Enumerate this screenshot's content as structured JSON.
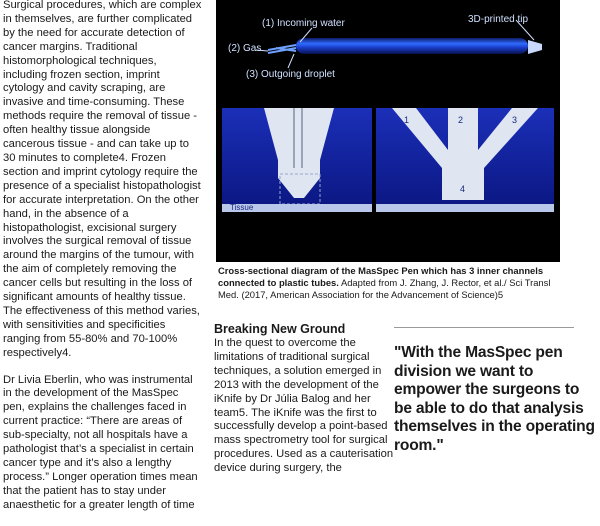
{
  "left_column": {
    "paragraphs": [
      "Surgical procedures, which are complex in themselves, are further complicated by the need for accurate detection of cancer margins. Traditional histomorphological techniques, including frozen section, imprint cytology and cavity scraping, are invasive and time-consuming. These methods require the removal of tissue - often healthy tissue alongside cancerous tissue - and can take up to 30 minutes to complete4. Frozen section and imprint cytology require the presence of a specialist histopathologist for accurate interpretation. On the other hand, in the absence of a histopathologist, excisional surgery involves the surgical removal of tissue around the margins of the tumour, with the aim of completely removing the cancer cells but resulting in the loss of significant amounts of healthy tissue. The effectiveness of this method varies, with sensitivities and specificities ranging from 55-80% and 70-100% respectively4.",
      "Dr Livia Eberlin, who was instrumental in the development of the MasSpec pen, explains the challenges faced in current practice: “There are areas of sub-specialty, not all hospitals have a pathologist that’s a specialist in certain cancer type and it’s also a lengthy process.” Longer operation times mean that the patient has to stay under anaesthetic for a greater length of time"
    ]
  },
  "figure": {
    "labels": {
      "incoming_water": "(1) Incoming water",
      "gas": "(2) Gas",
      "outgoing_droplet": "(3) Outgoing droplet",
      "tip": "3D-printed tip",
      "tissue": "Tissue",
      "ch1": "1",
      "ch2": "2",
      "ch3": "3",
      "ch4": "4"
    },
    "colors": {
      "background": "#000000",
      "accent": "#1e5bff",
      "label": "#cfe0ff"
    }
  },
  "caption": {
    "bold": "Cross-sectional diagram of the MasSpec Pen which has 3 inner channels connected to plastic tubes.",
    "normal": " Adapted from J. Zhang, J. Rector, et al./ Sci Transl Med. (2017, American Association for the Advancement of Science)5"
  },
  "middle_column": {
    "heading": "Breaking New Ground",
    "body": "In the quest to overcome the limitations of traditional surgical techniques, a solution emerged in 2013 with the development of the iKnife by Dr Júlia Balog and her team5. The iKnife was the first to successfully develop a point-based mass spectrometry tool for surgical procedures. Used as a cauterisation device during surgery, the"
  },
  "pull_quote": {
    "text": "\"With the MasSpec pen division we want to empower the surgeons to be able to do that analysis themselves in the operating room.\""
  }
}
